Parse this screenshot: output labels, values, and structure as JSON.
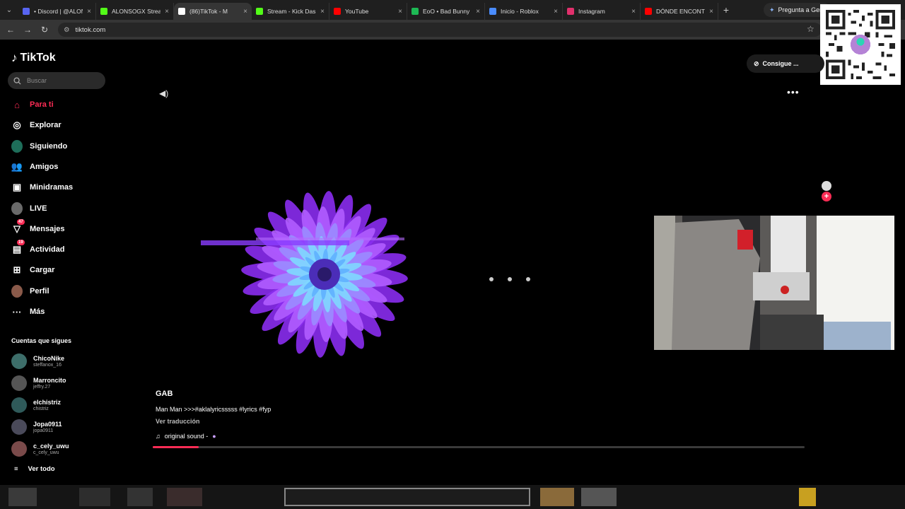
{
  "browser": {
    "tabs": [
      {
        "title": "• Discord | @ALON",
        "color": "#5865f2"
      },
      {
        "title": "ALONSOGX Strea",
        "color": "#53fc18"
      },
      {
        "title": "(86)TikTok - M",
        "color": "#ffffff"
      },
      {
        "title": "Stream - Kick Das",
        "color": "#53fc18"
      },
      {
        "title": "YouTube",
        "color": "#ff0000"
      },
      {
        "title": "EoO • Bad Bunny",
        "color": "#1db954"
      },
      {
        "title": "Inicio - Roblox",
        "color": "#4a8cff"
      },
      {
        "title": "Instagram",
        "color": "#e1306c"
      },
      {
        "title": "DÓNDE ENCONT",
        "color": "#ff0000"
      }
    ],
    "gemini_label": "Pregunta a Gem",
    "url": "tiktok.com"
  },
  "sidebar": {
    "brand": "TikTok",
    "search_placeholder": "Buscar",
    "nav": [
      {
        "label": "Para ti",
        "icon": "home-icon"
      },
      {
        "label": "Explorar",
        "icon": "compass-icon"
      },
      {
        "label": "Siguiendo",
        "icon": "following-icon"
      },
      {
        "label": "Amigos",
        "icon": "friends-icon"
      },
      {
        "label": "Minidramas",
        "icon": "film-icon"
      },
      {
        "label": "LIVE",
        "icon": "live-icon"
      },
      {
        "label": "Mensajes",
        "icon": "inbox-icon",
        "badge": "47"
      },
      {
        "label": "Actividad",
        "icon": "activity-icon",
        "badge": "19"
      },
      {
        "label": "Cargar",
        "icon": "upload-icon"
      },
      {
        "label": "Perfil",
        "icon": "profile-icon"
      },
      {
        "label": "Más",
        "icon": "more-icon"
      }
    ],
    "following_title": "Cuentas que sigues",
    "following": [
      {
        "name": "ChicoNike",
        "handle": "steffanox_16"
      },
      {
        "name": "Marroncito",
        "handle": "jeffry.27"
      },
      {
        "name": "elchistriz",
        "handle": "chistriz"
      },
      {
        "name": "Jopa0911",
        "handle": "jopa0911"
      },
      {
        "name": "c_cely_uwu",
        "handle": "c_cely_uwu"
      }
    ],
    "see_all": "Ver todo"
  },
  "header": {
    "get_app": "Consigue ..."
  },
  "video": {
    "author": "GAB",
    "description": "Man Man >>>#aklalyricsssss #lyrics #fyp",
    "translate": "Ver traducción",
    "sound": "original sound -",
    "progress": 0.07
  },
  "colors": {
    "accent": "#fe2c55"
  }
}
